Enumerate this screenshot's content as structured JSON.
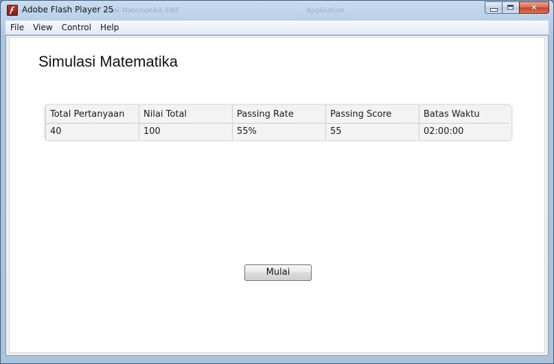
{
  "window": {
    "title": "Adobe Flash Player 25",
    "ghost_texts": [
      "ulasi Matematika.SWF",
      "Application"
    ]
  },
  "menu": {
    "items": [
      "File",
      "View",
      "Control",
      "Help"
    ]
  },
  "content": {
    "title": "Simulasi Matematika",
    "table": {
      "headers": [
        "Total Pertanyaan",
        "Nilai Total",
        "Passing Rate",
        "Passing Score",
        "Batas Waktu"
      ],
      "values": [
        "40",
        "100",
        "55%",
        "55",
        "02:00:00"
      ]
    },
    "start_button_label": "Mulai"
  },
  "colors": {
    "title_bar": "#b8cfe7",
    "close_button": "#c0432a",
    "stage_background": "#ffffff"
  },
  "icons": {
    "app": "flash-player-icon",
    "minimize": "minimize-icon",
    "maximize": "maximize-icon",
    "close": "close-icon"
  }
}
